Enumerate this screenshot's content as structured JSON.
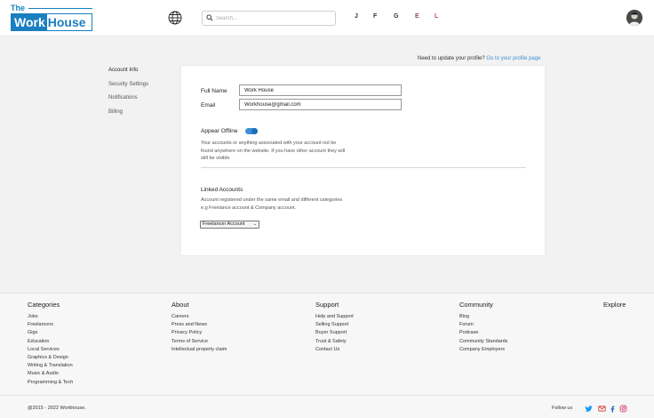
{
  "header": {
    "logo": {
      "the": "The",
      "work": "Work",
      "house": "House"
    },
    "search_placeholder": "Search...",
    "letters": [
      {
        "text": "J",
        "color": "#333333"
      },
      {
        "text": "F",
        "color": "#333333"
      },
      {
        "text": "G",
        "color": "#333333"
      },
      {
        "text": "E",
        "color": "#8a4a6a"
      },
      {
        "text": "L",
        "color": "#c04a60"
      }
    ]
  },
  "profile_hint": {
    "text": "Need to update your profile?",
    "link": "Go to your profile page"
  },
  "sidenav": [
    "Account Info",
    "Security Settings",
    "Notifications",
    "Billing"
  ],
  "form": {
    "full_name_label": "Full Name",
    "full_name_value": "Work House",
    "email_label": "Email",
    "email_value": "Workhouse@gmail.com",
    "appear_offline_label": "Appear Offline",
    "appear_offline_text_1": "Your accounts or anything associated with your account not be",
    "appear_offline_text_2": "found anywhere on the website. If you have other account they will",
    "appear_offline_text_3": "still be visible",
    "linked_label": "Linked Accounts",
    "linked_text_1": "Account registered under the same email and different categories",
    "linked_text_2": "e.g Freelance account & Company account.",
    "linked_select": "Freelancer Account"
  },
  "footer": {
    "columns": [
      {
        "title": "Categories",
        "items": [
          "Jobs",
          "Freelancers",
          "Gigs",
          "Education",
          "Local Services",
          "Graphics & Design",
          "Writing & Translation",
          "Music & Audio",
          "Programming & Tech"
        ]
      },
      {
        "title": "About",
        "items": [
          "Careers",
          "Press and News",
          "Privacy Policy",
          "Terms of Service",
          "Intellectual property claim"
        ]
      },
      {
        "title": "Support",
        "items": [
          "Help and Support",
          "Selling Support",
          "Buyer Support",
          "Trust & Safety",
          "Contact Us"
        ]
      },
      {
        "title": "Community",
        "items": [
          "Blog",
          "Forum",
          "Podcase",
          "Community Standards",
          "Company Employers"
        ]
      },
      {
        "title": "Explore",
        "items": []
      }
    ],
    "copyright": "@2015 - 2022 Workhouse.",
    "follow_us": "Follow us"
  },
  "colors": {
    "brand": "#1a7fc0",
    "link": "#3d8fd6"
  }
}
